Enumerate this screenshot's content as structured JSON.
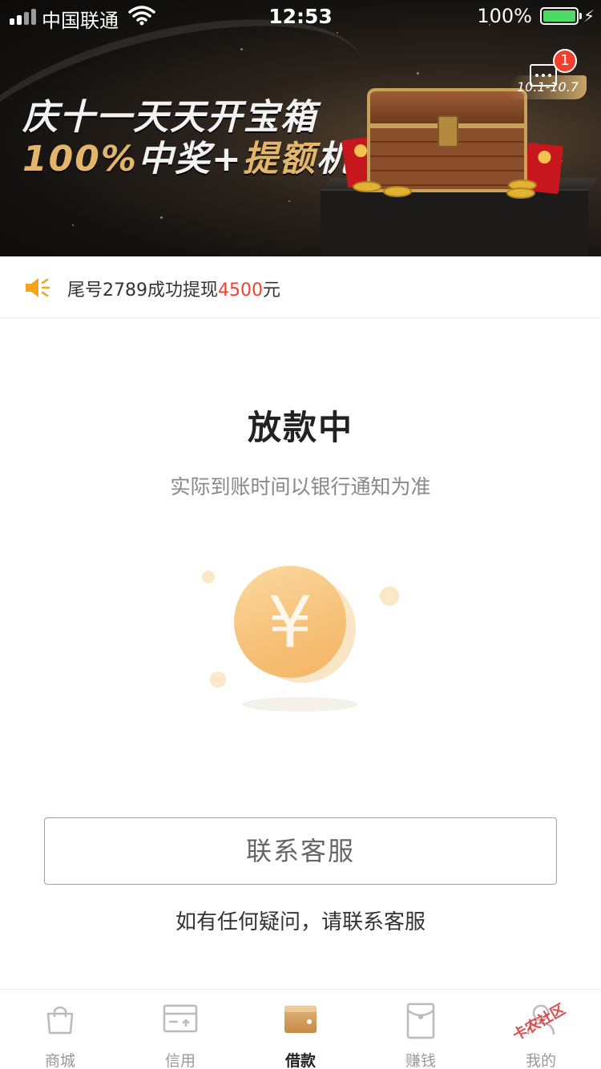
{
  "status_bar": {
    "carrier": "中国联通",
    "time": "12:53",
    "battery": "100%"
  },
  "banner": {
    "line1": "庆十一天天开宝箱",
    "line2_part1": "100%",
    "line2_part2": "中奖",
    "line2_part3": "+",
    "line2_part4": "提额",
    "line2_part5": "机会",
    "date_range": "10.1-10.7",
    "message_badge": "1"
  },
  "notice": {
    "prefix": "尾号2789成功提现",
    "amount": "4500",
    "suffix": "元"
  },
  "status": {
    "title": "放款中",
    "subtitle": "实际到账时间以银行通知为准",
    "coin_symbol": "¥"
  },
  "contact": {
    "button_label": "联系客服",
    "hint": "如有任何疑问，请联系客服"
  },
  "tabbar": {
    "items": [
      {
        "label": "商城",
        "icon": "shopping-bag-icon"
      },
      {
        "label": "信用",
        "icon": "credit-card-icon"
      },
      {
        "label": "借款",
        "icon": "wallet-icon",
        "active": true
      },
      {
        "label": "赚钱",
        "icon": "red-envelope-icon"
      },
      {
        "label": "我的",
        "icon": "user-icon"
      }
    ]
  },
  "watermark": "卡农社区",
  "colors": {
    "accent_red": "#f0412f",
    "coin_gold": "#f6c27a",
    "active_tab": "#222222"
  }
}
